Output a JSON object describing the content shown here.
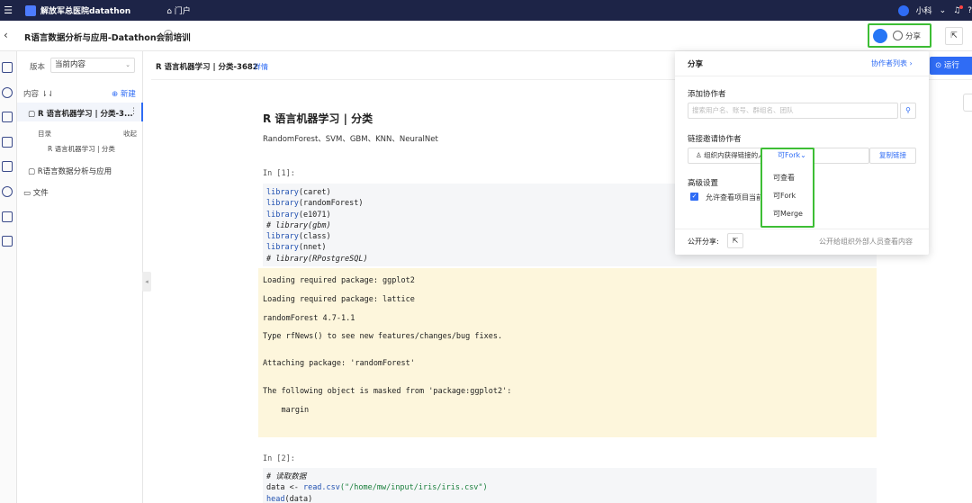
{
  "topbar": {
    "brand": "解放军总医院datathon",
    "portal": "门户",
    "user": "小科",
    "help": "?"
  },
  "header": {
    "title": "R语言数据分析与应用-Datathon会前培训",
    "share_label": "分享"
  },
  "sidebar": {
    "version_label": "版本",
    "version_value": "当前内容",
    "content_label": "内容 ⇂⇃",
    "new_label": "新建",
    "notebooks": [
      {
        "label": "R 语言机器学习 | 分类-3..."
      },
      {
        "label": "R语言数据分析与应用"
      }
    ],
    "toc_label": "目录",
    "collapse_label": "收起",
    "toc_items": [
      "R 语言机器学习 | 分类"
    ],
    "files_label": "文件"
  },
  "notebook": {
    "title": "R 语言机器学习 | 分类-3682",
    "detail_link": "详情",
    "run_label": "运行",
    "md_title": "R 语言机器学习 | 分类",
    "md_subtitle": "RandomForest、SVM、GBM、KNN、NeuralNet",
    "cell1": {
      "prompt": "In [1]:",
      "lines": [
        {
          "kw": "library",
          "rest": "(caret)",
          "comment": false
        },
        {
          "kw": "library",
          "rest": "(randomForest)",
          "comment": false
        },
        {
          "kw": "library",
          "rest": "(e1071)",
          "comment": false
        },
        {
          "kw": "",
          "rest": "# library(gbm)",
          "comment": true
        },
        {
          "kw": "library",
          "rest": "(class)",
          "comment": false
        },
        {
          "kw": "library",
          "rest": "(nnet)",
          "comment": false
        },
        {
          "kw": "",
          "rest": "# library(RPostgreSQL)",
          "comment": true
        }
      ],
      "output": [
        "Loading required package: ggplot2",
        "Loading required package: lattice",
        "randomForest 4.7-1.1",
        "Type rfNews() to see new features/changes/bug fixes.",
        "Attaching package: 'randomForest'",
        "The following object is masked from 'package:ggplot2':",
        "    margin"
      ]
    },
    "cell2": {
      "prompt": "In [2]:",
      "comment": "# 读取数据",
      "line2_a": "data <- ",
      "line2_fn": "read.csv",
      "line2_str": "(\"/home/mw/input/iris/iris.csv\")",
      "line3_fn": "head",
      "line3_rest": "(data)"
    }
  },
  "share_panel": {
    "title": "分享",
    "collab_list": "协作者列表 ›",
    "add_label": "添加协作者",
    "search_placeholder": "搜索用户名、账号、群组名、团队",
    "link_label": "链接邀请协作者",
    "link_text": "组织内获得链接的人",
    "copy_label": "复制链接",
    "advanced_label": "高级设置",
    "allow_label": "允许查看项目当前",
    "public_label": "公开分享:",
    "public_hint": "公开给组织外部人员查看内容"
  },
  "permission": {
    "selected": "可Fork",
    "options": [
      "可查看",
      "可Fork",
      "可Merge"
    ]
  },
  "colors": {
    "accent": "#2f6cf5",
    "highlight": "#3dbe35",
    "topbar": "#1d2447"
  }
}
